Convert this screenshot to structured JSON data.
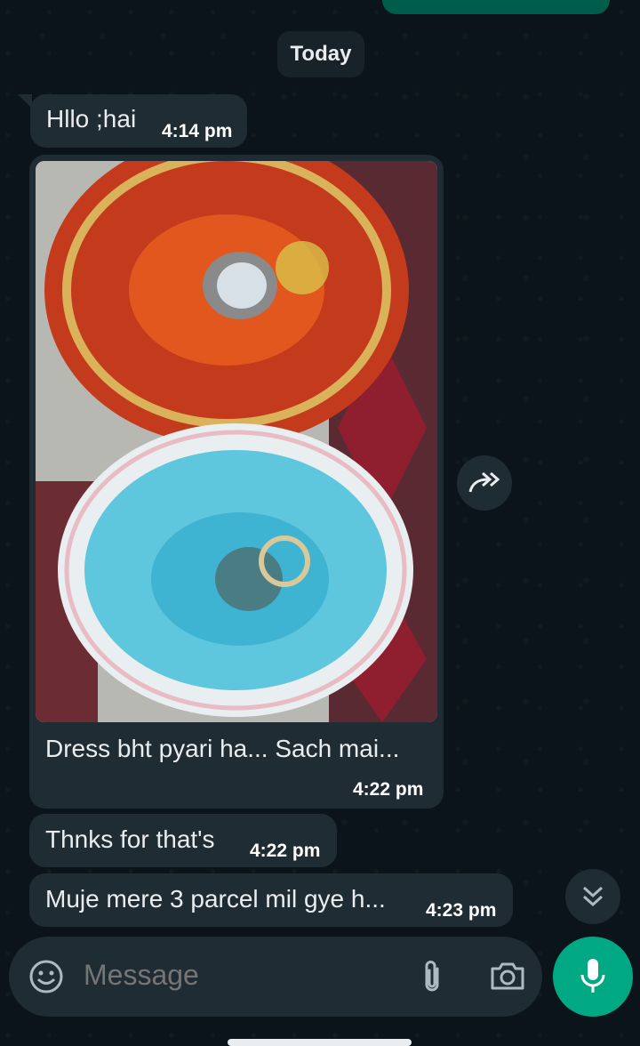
{
  "date_divider": "Today",
  "messages": [
    {
      "text": "Hllo ;hai",
      "time": "4:14 pm"
    },
    {
      "caption": "Dress bht pyari ha... Sach mai...",
      "time": "4:22 pm"
    },
    {
      "text": "Thnks for that's",
      "time": "4:22 pm"
    },
    {
      "text": "Muje mere 3 parcel mil gye h...",
      "time": "4:23 pm"
    }
  ],
  "composer": {
    "placeholder": "Message"
  },
  "icons": {
    "emoji": "emoji-icon",
    "attach": "paperclip-icon",
    "camera": "camera-icon",
    "mic": "microphone-icon",
    "forward": "forward-icon",
    "scroll_down": "double-chevron-down-icon"
  },
  "colors": {
    "background": "#0b141a",
    "incoming_bubble": "#202c33",
    "outgoing_bubble": "#005c4b",
    "accent": "#00a884"
  }
}
